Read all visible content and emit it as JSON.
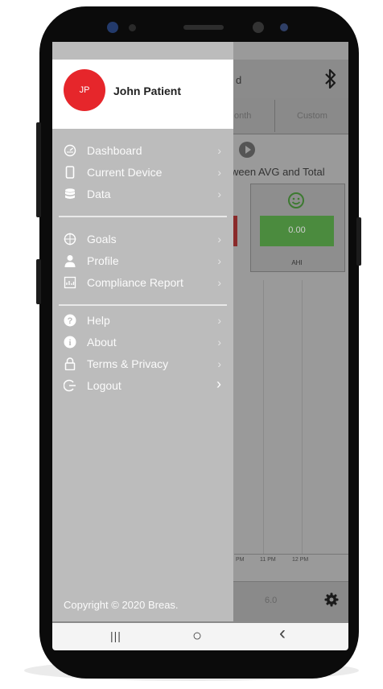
{
  "user": {
    "initials": "JP",
    "name": "John Patient"
  },
  "menu": {
    "group1": [
      {
        "id": "dashboard",
        "label": "Dashboard",
        "icon": "speedometer-icon"
      },
      {
        "id": "current-device",
        "label": "Current Device",
        "icon": "phone-device-icon"
      },
      {
        "id": "data",
        "label": "Data",
        "icon": "database-icon"
      }
    ],
    "group2": [
      {
        "id": "goals",
        "label": "Goals",
        "icon": "target-icon"
      },
      {
        "id": "profile",
        "label": "Profile",
        "icon": "person-icon"
      },
      {
        "id": "compliance-report",
        "label": "Compliance Report",
        "icon": "report-icon"
      }
    ],
    "group3": [
      {
        "id": "help",
        "label": "Help",
        "icon": "help-circle-icon"
      },
      {
        "id": "about",
        "label": "About",
        "icon": "info-circle-icon"
      },
      {
        "id": "terms-privacy",
        "label": "Terms & Privacy",
        "icon": "lock-icon"
      },
      {
        "id": "logout",
        "label": "Logout",
        "icon": "logout-icon"
      }
    ],
    "chevron": "›"
  },
  "footer": {
    "copyright": "Copyright © 2020 Breas."
  },
  "background_app": {
    "header_fragment": "d",
    "tabs": [
      "onth",
      "Custom"
    ],
    "subtitle_fragment": "ween AVG and Total",
    "tile_value": "0.00",
    "tile_label": "AHI",
    "time_labels": [
      "PM",
      "11 PM",
      "12 PM"
    ],
    "bottom_value": "6.0"
  },
  "nav_bar": {
    "recents": "|||",
    "home": "○",
    "back": "‹"
  },
  "colors": {
    "avatar": "#e6262b",
    "drawer": "#bcbcbc",
    "tile_green": "#4b8b3e"
  }
}
